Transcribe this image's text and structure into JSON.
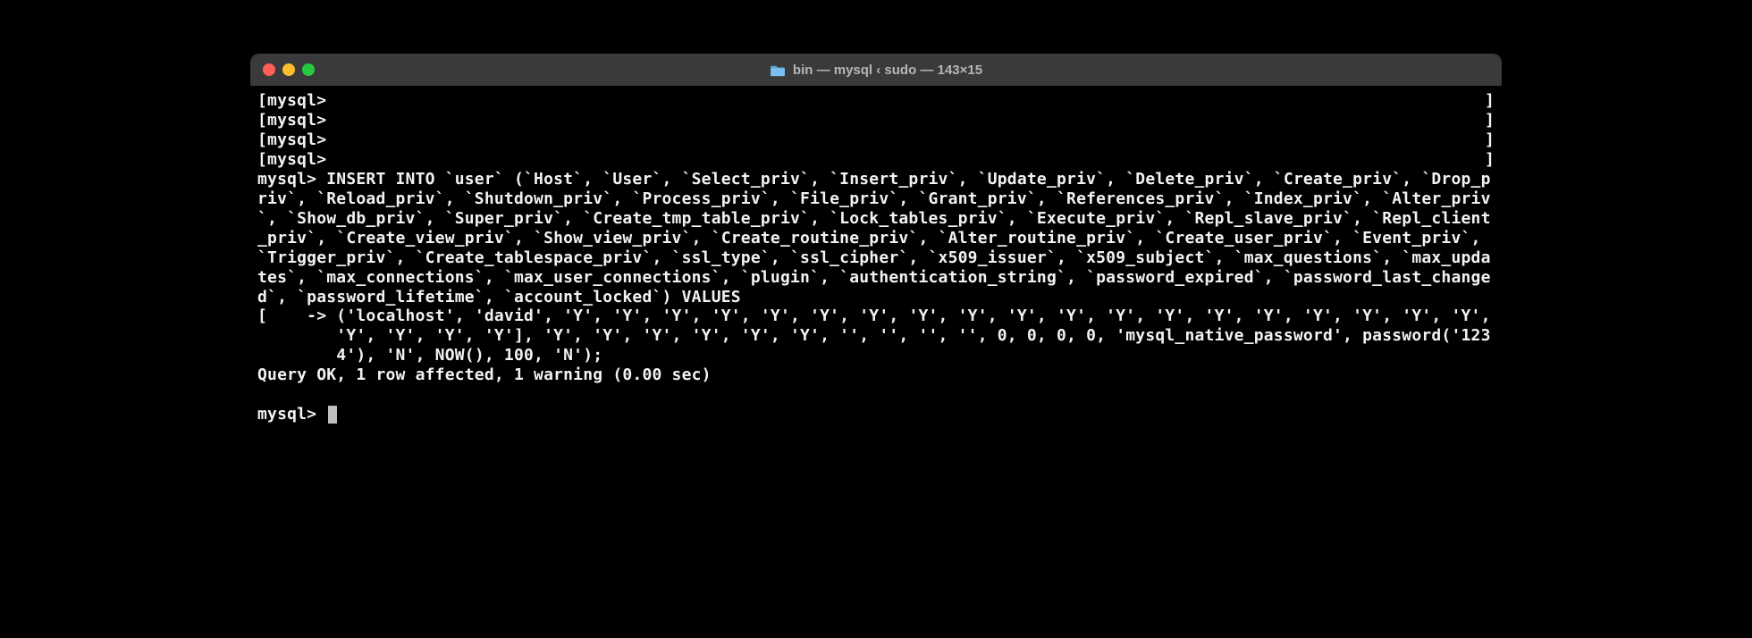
{
  "window": {
    "title": "bin — mysql ‹ sudo — 143×15"
  },
  "terminal": {
    "empty_prompts": [
      "mysql>",
      "mysql>",
      "mysql>",
      "mysql>"
    ],
    "sql_block": "mysql> INSERT INTO `user` (`Host`, `User`, `Select_priv`, `Insert_priv`, `Update_priv`, `Delete_priv`, `Create_priv`, `Drop_priv`, `Reload_priv`, `Shutdown_priv`, `Process_priv`, `File_priv`, `Grant_priv`, `References_priv`, `Index_priv`, `Alter_priv`, `Show_db_priv`, `Super_priv`, `Create_tmp_table_priv`, `Lock_tables_priv`, `Execute_priv`, `Repl_slave_priv`, `Repl_client_priv`, `Create_view_priv`, `Show_view_priv`, `Create_routine_priv`, `Alter_routine_priv`, `Create_user_priv`, `Event_priv`, `Trigger_priv`, `Create_tablespace_priv`, `ssl_type`, `ssl_cipher`, `x509_issuer`, `x509_subject`, `max_questions`, `max_updates`, `max_connections`, `max_user_connections`, `plugin`, `authentication_string`, `password_expired`, `password_last_changed`, `password_lifetime`, `account_locked`) VALUES",
    "cont_left": "[    -> ",
    "cont_body": "('localhost', 'david', 'Y', 'Y', 'Y', 'Y', 'Y', 'Y', 'Y', 'Y', 'Y', 'Y', 'Y', 'Y', 'Y', 'Y', 'Y', 'Y', 'Y', 'Y', 'Y', 'Y', 'Y', 'Y', 'Y'], 'Y', 'Y', 'Y', 'Y', 'Y', 'Y', '', '', '', '', 0, 0, 0, 0, 'mysql_native_password', password('1234'), 'N', NOW(), 100, 'N');",
    "result": "Query OK, 1 row affected, 1 warning (0.00 sec)",
    "final_prompt": "mysql> "
  }
}
